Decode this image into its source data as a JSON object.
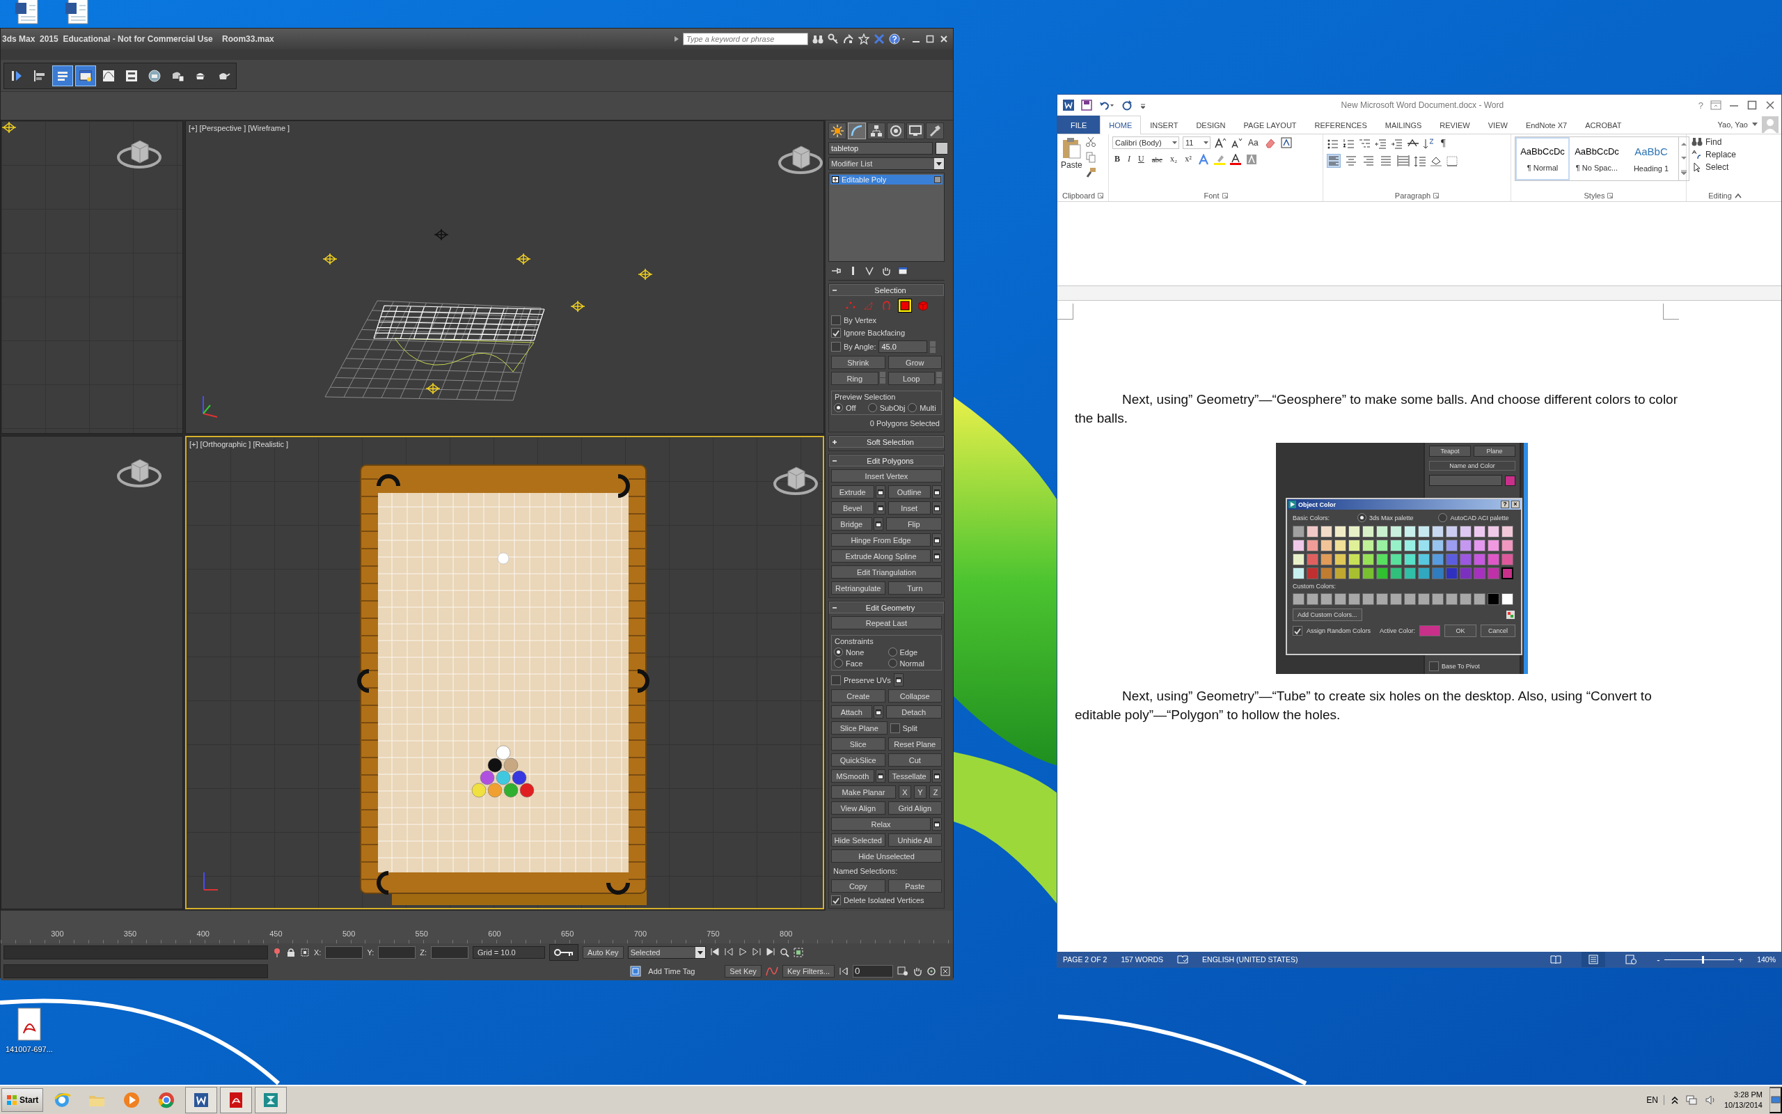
{
  "desktop": {
    "icons": [
      {
        "kind": "doc"
      },
      {
        "kind": "doc"
      },
      {
        "kind": "pdf",
        "label": "141007-697..."
      }
    ]
  },
  "max": {
    "title": "3ds Max  2015  Educational - Not for Commercial Use    Room33.max",
    "search": {
      "placeholder": "Type a keyword or phrase"
    },
    "toolbar": [
      {
        "selected": false
      },
      {
        "selected": false
      },
      {
        "selected": true
      },
      {
        "selected": true
      },
      {
        "selected": false
      },
      {
        "selected": false
      },
      {
        "selected": false
      },
      {
        "selected": false
      },
      {
        "selected": false
      },
      {
        "selected": false
      }
    ],
    "viewports": [
      {
        "kind": "perspective",
        "label": "[+] [Perspective ] [Wireframe ]",
        "active": false
      },
      {
        "kind": "top",
        "label": "[+] [Orthographic ] [Realistic ]",
        "active": true
      }
    ],
    "command_panel": {
      "tabs": [
        {
          "selected": false
        },
        {
          "selected": true
        },
        {
          "selected": false
        },
        {
          "selected": false
        },
        {
          "selected": false
        },
        {
          "selected": false
        }
      ],
      "object_name": "tabletop",
      "modifier_list": "Modifier List",
      "stack": [
        {
          "label": "Editable Poly",
          "selected": true
        }
      ],
      "rollouts": [
        {
          "title": "Selection",
          "expanded": true,
          "items": [
            {
              "kind": "levels",
              "items": [
                {
                  "selected": false
                },
                {
                  "selected": false
                },
                {
                  "selected": false
                },
                {
                  "selected": true
                },
                {
                  "selected": false
                }
              ]
            },
            {
              "kind": "row",
              "controls": [
                {
                  "kind": "checkbox",
                  "label": "By Vertex",
                  "checked": false
                }
              ]
            },
            {
              "kind": "row",
              "controls": [
                {
                  "kind": "checkbox",
                  "label": "Ignore Backfacing",
                  "checked": true
                }
              ]
            },
            {
              "kind": "row",
              "controls": [
                {
                  "kind": "spinner-check",
                  "label": "By Angle:",
                  "value": "45.0",
                  "checked": false
                }
              ]
            },
            {
              "kind": "row",
              "controls": [
                {
                  "kind": "button",
                  "label": "Shrink"
                },
                {
                  "kind": "button",
                  "label": "Grow"
                }
              ]
            },
            {
              "kind": "row",
              "controls": [
                {
                  "kind": "stepper-button",
                  "label": "Ring"
                },
                {
                  "kind": "stepper-button",
                  "label": "Loop"
                }
              ]
            },
            {
              "kind": "group",
              "label": "Preview Selection",
              "rows": [
                [
                  {
                    "kind": "radio",
                    "label": "Off",
                    "selected": true
                  },
                  {
                    "kind": "radio",
                    "label": "SubObj",
                    "selected": false
                  },
                  {
                    "kind": "radio",
                    "label": "Multi",
                    "selected": false
                  }
                ]
              ]
            },
            {
              "kind": "note",
              "text": "0 Polygons Selected"
            }
          ]
        },
        {
          "title": "Soft Selection",
          "expanded": false
        },
        {
          "title": "Edit Polygons",
          "expanded": true,
          "items": [
            {
              "kind": "row",
              "controls": [
                {
                  "kind": "button",
                  "label": "Insert Vertex"
                }
              ]
            },
            {
              "kind": "row",
              "controls": [
                {
                  "kind": "button-opt",
                  "label": "Extrude"
                },
                {
                  "kind": "button-opt",
                  "label": "Outline"
                }
              ]
            },
            {
              "kind": "row",
              "controls": [
                {
                  "kind": "button-opt",
                  "label": "Bevel"
                },
                {
                  "kind": "button-opt",
                  "label": "Inset"
                }
              ]
            },
            {
              "kind": "row",
              "controls": [
                {
                  "kind": "button-opt",
                  "label": "Bridge"
                },
                {
                  "kind": "button",
                  "label": "Flip"
                }
              ]
            },
            {
              "kind": "row",
              "controls": [
                {
                  "kind": "button-opt",
                  "label": "Hinge From Edge"
                }
              ]
            },
            {
              "kind": "row",
              "controls": [
                {
                  "kind": "button-opt",
                  "label": "Extrude Along Spline"
                }
              ]
            },
            {
              "kind": "row",
              "controls": [
                {
                  "kind": "button",
                  "label": "Edit Triangulation"
                }
              ]
            },
            {
              "kind": "row",
              "controls": [
                {
                  "kind": "button",
                  "label": "Retriangulate"
                },
                {
                  "kind": "button",
                  "label": "Turn"
                }
              ]
            }
          ]
        },
        {
          "title": "Edit Geometry",
          "expanded": true,
          "items": [
            {
              "kind": "row",
              "controls": [
                {
                  "kind": "button",
                  "label": "Repeat Last"
                }
              ]
            },
            {
              "kind": "group",
              "label": "Constraints",
              "rows": [
                [
                  {
                    "kind": "radio",
                    "label": "None",
                    "selected": true
                  },
                  {
                    "kind": "radio",
                    "label": "Edge",
                    "selected": false
                  }
                ],
                [
                  {
                    "kind": "radio",
                    "label": "Face",
                    "selected": false
                  },
                  {
                    "kind": "radio",
                    "label": "Normal",
                    "selected": false
                  }
                ]
              ]
            },
            {
              "kind": "row",
              "controls": [
                {
                  "kind": "checkbox-opt",
                  "label": "Preserve UVs",
                  "checked": false
                }
              ]
            },
            {
              "kind": "row",
              "controls": [
                {
                  "kind": "button",
                  "label": "Create"
                },
                {
                  "kind": "button",
                  "label": "Collapse"
                }
              ]
            },
            {
              "kind": "row",
              "controls": [
                {
                  "kind": "button-opt",
                  "label": "Attach"
                },
                {
                  "kind": "button",
                  "label": "Detach"
                }
              ]
            },
            {
              "kind": "row",
              "controls": [
                {
                  "kind": "button",
                  "label": "Slice Plane"
                },
                {
                  "kind": "checkbox",
                  "label": "Split",
                  "checked": false
                }
              ]
            },
            {
              "kind": "row",
              "controls": [
                {
                  "kind": "button",
                  "label": "Slice"
                },
                {
                  "kind": "button",
                  "label": "Reset Plane"
                }
              ]
            },
            {
              "kind": "row",
              "controls": [
                {
                  "kind": "button",
                  "label": "QuickSlice"
                },
                {
                  "kind": "button",
                  "label": "Cut"
                }
              ]
            },
            {
              "kind": "row",
              "controls": [
                {
                  "kind": "button-opt",
                  "label": "MSmooth"
                },
                {
                  "kind": "button-opt",
                  "label": "Tessellate"
                }
              ]
            },
            {
              "kind": "row",
              "controls": [
                {
                  "kind": "button",
                  "label": "Make Planar"
                },
                {
                  "kind": "small-button",
                  "label": "X"
                },
                {
                  "kind": "small-button",
                  "label": "Y"
                },
                {
                  "kind": "small-button",
                  "label": "Z"
                }
              ]
            },
            {
              "kind": "row",
              "controls": [
                {
                  "kind": "button",
                  "label": "View Align"
                },
                {
                  "kind": "button",
                  "label": "Grid Align"
                }
              ]
            },
            {
              "kind": "row",
              "controls": [
                {
                  "kind": "button-opt",
                  "label": "Relax"
                }
              ]
            },
            {
              "kind": "row",
              "controls": [
                {
                  "kind": "button",
                  "label": "Hide Selected"
                },
                {
                  "kind": "button",
                  "label": "Unhide All"
                }
              ]
            },
            {
              "kind": "row",
              "controls": [
                {
                  "kind": "button",
                  "label": "Hide Unselected"
                }
              ]
            },
            {
              "kind": "note",
              "text": "Named Selections:"
            },
            {
              "kind": "row",
              "controls": [
                {
                  "kind": "button",
                  "label": "Copy"
                },
                {
                  "kind": "button",
                  "label": "Paste"
                }
              ]
            },
            {
              "kind": "row",
              "controls": [
                {
                  "kind": "checkbox",
                  "label": "Delete Isolated Vertices",
                  "checked": true
                }
              ]
            }
          ]
        }
      ]
    },
    "ruler": [
      "300",
      "350",
      "400",
      "450",
      "500",
      "550",
      "600",
      "650",
      "700",
      "750",
      "800"
    ],
    "status": {
      "x_label": "X:",
      "y_label": "Y:",
      "z_label": "Z:",
      "grid": "Grid = 10.0",
      "add_time_tag": "Add Time Tag",
      "auto_key": "Auto Key",
      "key_mode": "Selected",
      "set_key": "Set Key",
      "key_filters": "Key Filters...",
      "frame": "0"
    }
  },
  "word": {
    "title": "New Microsoft Word Document.docx - Word",
    "help": "?",
    "tabs": [
      {
        "label": "FILE",
        "kind": "file",
        "selected": false
      },
      {
        "label": "HOME",
        "kind": "tab",
        "selected": true
      },
      {
        "label": "INSERT",
        "kind": "tab",
        "selected": false
      },
      {
        "label": "DESIGN",
        "kind": "tab",
        "selected": false
      },
      {
        "label": "PAGE LAYOUT",
        "kind": "tab",
        "selected": false
      },
      {
        "label": "REFERENCES",
        "kind": "tab",
        "selected": false
      },
      {
        "label": "MAILINGS",
        "kind": "tab",
        "selected": false
      },
      {
        "label": "REVIEW",
        "kind": "tab",
        "selected": false
      },
      {
        "label": "VIEW",
        "kind": "tab",
        "selected": false
      },
      {
        "label": "EndNote X7",
        "kind": "tab",
        "selected": false
      },
      {
        "label": "ACROBAT",
        "kind": "tab",
        "selected": false
      }
    ],
    "user": "Yao, Yao",
    "ribbon": {
      "groups": [
        "Clipboard",
        "Font",
        "Paragraph",
        "Styles",
        "Editing"
      ],
      "paste": "Paste",
      "font_name": "Calibri (Body)",
      "font_size": "11",
      "change_case": "Aa",
      "font_buttons": [
        "B",
        "I",
        "U",
        "abc",
        "x₂",
        "x²"
      ],
      "pilcrow": "¶",
      "alignment": [
        {
          "selected": true
        },
        {
          "selected": false
        },
        {
          "selected": false
        },
        {
          "selected": false
        },
        {
          "selected": false
        }
      ],
      "styles": [
        {
          "sample": "AaBbCcDc",
          "name": "¶ Normal",
          "kind": "body",
          "selected": true
        },
        {
          "sample": "AaBbCcDc",
          "name": "¶ No Spac...",
          "kind": "body",
          "selected": false
        },
        {
          "sample": "AaBbC",
          "name": "Heading 1",
          "kind": "heading",
          "selected": false
        }
      ],
      "editing": [
        "Find",
        "Replace",
        "Select"
      ]
    },
    "document": {
      "paragraphs": [
        "Next, using” Geometry”—“Geosphere” to make some balls. And choose different colors to color the balls.",
        "Next, using” Geometry”—“Tube” to create six holes on the desktop. Also, using “Convert to editable poly”—“Polygon” to hollow the holes."
      ],
      "figure": {
        "buttons": [
          "Teapot",
          "Plane"
        ],
        "rollout": "Name and Color",
        "dialog": {
          "title": "Object Color",
          "help": "?",
          "close": "×",
          "basic_label": "Basic Colors:",
          "palettes": [
            {
              "label": "3ds Max palette",
              "selected": true
            },
            {
              "label": "AutoCAD ACI palette",
              "selected": false
            }
          ],
          "basic": [
            [
              {
                "color": "#a0a0a0",
                "selected": false
              },
              {
                "color": "#f0c8c8",
                "selected": false
              },
              {
                "color": "#f0dcc8",
                "selected": false
              },
              {
                "color": "#f0ecc8",
                "selected": false
              },
              {
                "color": "#e8f0c8",
                "selected": false
              },
              {
                "color": "#d8f0c8",
                "selected": false
              },
              {
                "color": "#c8f0cc",
                "selected": false
              },
              {
                "color": "#c8f0dc",
                "selected": false
              },
              {
                "color": "#c8f0ec",
                "selected": false
              },
              {
                "color": "#c8e8f0",
                "selected": false
              },
              {
                "color": "#c8d8f0",
                "selected": false
              },
              {
                "color": "#ccccf0",
                "selected": false
              },
              {
                "color": "#dcc8f0",
                "selected": false
              },
              {
                "color": "#ecc8f0",
                "selected": false
              },
              {
                "color": "#f0c8e8",
                "selected": false
              },
              {
                "color": "#f0c8d8",
                "selected": false
              }
            ],
            [
              {
                "color": "#f0c8e8",
                "selected": false
              },
              {
                "color": "#f09c98",
                "selected": false
              },
              {
                "color": "#f0c498",
                "selected": false
              },
              {
                "color": "#f0e098",
                "selected": false
              },
              {
                "color": "#e0f098",
                "selected": false
              },
              {
                "color": "#c0f098",
                "selected": false
              },
              {
                "color": "#98f0a0",
                "selected": false
              },
              {
                "color": "#98f0c8",
                "selected": false
              },
              {
                "color": "#98f0e4",
                "selected": false
              },
              {
                "color": "#98e0f0",
                "selected": false
              },
              {
                "color": "#98c4f0",
                "selected": false
              },
              {
                "color": "#9c9cf0",
                "selected": false
              },
              {
                "color": "#c498f0",
                "selected": false
              },
              {
                "color": "#e498f0",
                "selected": false
              },
              {
                "color": "#f098e0",
                "selected": false
              },
              {
                "color": "#f098c0",
                "selected": false
              }
            ],
            [
              {
                "color": "#e8f0c8",
                "selected": false
              },
              {
                "color": "#e06060",
                "selected": false
              },
              {
                "color": "#e09c58",
                "selected": false
              },
              {
                "color": "#e0c858",
                "selected": false
              },
              {
                "color": "#c8e058",
                "selected": false
              },
              {
                "color": "#98e058",
                "selected": false
              },
              {
                "color": "#58e060",
                "selected": false
              },
              {
                "color": "#58e09c",
                "selected": false
              },
              {
                "color": "#58e0c8",
                "selected": false
              },
              {
                "color": "#58c8e0",
                "selected": false
              },
              {
                "color": "#589ce0",
                "selected": false
              },
              {
                "color": "#5c5ce0",
                "selected": false
              },
              {
                "color": "#9c58e0",
                "selected": false
              },
              {
                "color": "#c858e0",
                "selected": false
              },
              {
                "color": "#e058c8",
                "selected": false
              },
              {
                "color": "#e0589c",
                "selected": false
              }
            ],
            [
              {
                "color": "#c8f0f0",
                "selected": false
              },
              {
                "color": "#c03030",
                "selected": false
              },
              {
                "color": "#c07c30",
                "selected": false
              },
              {
                "color": "#c0a830",
                "selected": false
              },
              {
                "color": "#a8c030",
                "selected": false
              },
              {
                "color": "#78c030",
                "selected": false
              },
              {
                "color": "#30c030",
                "selected": false
              },
              {
                "color": "#30c07c",
                "selected": false
              },
              {
                "color": "#30c0a8",
                "selected": false
              },
              {
                "color": "#30a8c0",
                "selected": false
              },
              {
                "color": "#307cc0",
                "selected": false
              },
              {
                "color": "#3030c0",
                "selected": false
              },
              {
                "color": "#7c30c0",
                "selected": false
              },
              {
                "color": "#a830c0",
                "selected": false
              },
              {
                "color": "#c030a8",
                "selected": false
              },
              {
                "color": "#c8308a",
                "selected": true
              }
            ]
          ],
          "custom_label": "Custom Colors:",
          "custom": [
            {
              "color": "#a8a8a8",
              "selected": false
            },
            {
              "color": "#a8a8a8",
              "selected": false
            },
            {
              "color": "#a8a8a8",
              "selected": false
            },
            {
              "color": "#a8a8a8",
              "selected": false
            },
            {
              "color": "#a8a8a8",
              "selected": false
            },
            {
              "color": "#a8a8a8",
              "selected": false
            },
            {
              "color": "#a8a8a8",
              "selected": false
            },
            {
              "color": "#a8a8a8",
              "selected": false
            },
            {
              "color": "#a8a8a8",
              "selected": false
            },
            {
              "color": "#a8a8a8",
              "selected": false
            },
            {
              "color": "#a8a8a8",
              "selected": false
            },
            {
              "color": "#a8a8a8",
              "selected": false
            },
            {
              "color": "#a8a8a8",
              "selected": false
            },
            {
              "color": "#a8a8a8",
              "selected": false
            },
            {
              "color": "#000000",
              "selected": false
            },
            {
              "color": "#ffffff",
              "selected": false
            }
          ],
          "add_custom": "Add Custom Colors...",
          "random": {
            "label": "Assign Random Colors",
            "checked": true
          },
          "active_label": "Active Color:",
          "ok": "OK",
          "cancel": "Cancel"
        },
        "base_to_pivot": {
          "label": "Base To Pivot",
          "checked": false
        }
      }
    },
    "status": {
      "page": "PAGE 2 OF 2",
      "words": "157 WORDS",
      "language": "ENGLISH (UNITED STATES)",
      "views": [
        {
          "selected": false
        },
        {
          "selected": true
        },
        {
          "selected": false
        }
      ],
      "zoom_out": "-",
      "zoom_in": "+",
      "zoom_slider": {
        "level": 0.55
      },
      "zoom": "140%"
    }
  },
  "taskbar": {
    "start": "Start",
    "apps": [
      {
        "kind": "ie",
        "active": false
      },
      {
        "kind": "explorer",
        "active": false
      },
      {
        "kind": "media",
        "active": false
      },
      {
        "kind": "chrome",
        "active": false
      },
      {
        "kind": "word",
        "active": true
      },
      {
        "kind": "acrobat",
        "active": true
      },
      {
        "kind": "max",
        "active": true
      }
    ],
    "language": "EN",
    "time": "3:28 PM",
    "date": "10/13/2014"
  }
}
